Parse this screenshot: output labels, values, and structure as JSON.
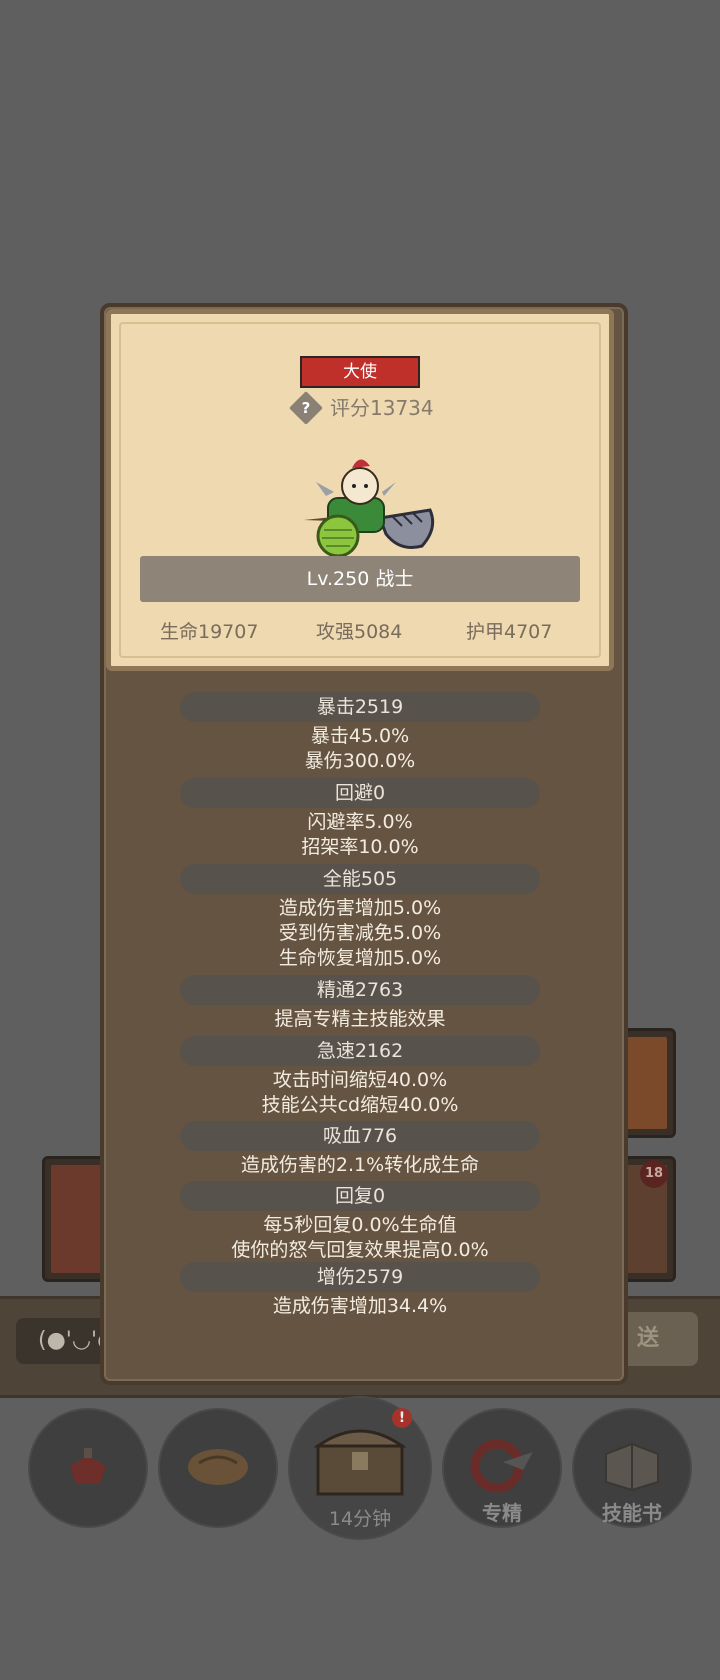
{
  "colors": {
    "overlay": "#5f5f5f",
    "panel": "#665442",
    "card": "#efd9b1",
    "title_badge": "#c0302b",
    "stat_header": "#57524c"
  },
  "background": {
    "chat_placeholder": "(●'◡'●",
    "send_label": "送",
    "badge_count": "18",
    "alert_mark": "!",
    "bottom_buttons": [
      {
        "icon": "potion-icon",
        "label": ""
      },
      {
        "icon": "bread-icon",
        "label": ""
      },
      {
        "icon": "treasure-chest-icon",
        "label": "14分钟"
      },
      {
        "icon": "specialize-icon",
        "label": "专精"
      },
      {
        "icon": "skill-book-icon",
        "label": "技能书"
      }
    ]
  },
  "hero": {
    "title": "大使",
    "score": "评分13734",
    "help_icon": "?",
    "level_class": "Lv.250 战士",
    "base_stats": {
      "hp": "生命19707",
      "attack": "攻强5084",
      "armor": "护甲4707"
    }
  },
  "stats": [
    {
      "header": "暴击2519",
      "lines": [
        "暴击45.0%",
        "暴伤300.0%"
      ]
    },
    {
      "header": "回避0",
      "lines": [
        "闪避率5.0%",
        "招架率10.0%"
      ]
    },
    {
      "header": "全能505",
      "lines": [
        "造成伤害增加5.0%",
        "受到伤害减免5.0%",
        "生命恢复增加5.0%"
      ]
    },
    {
      "header": "精通2763",
      "lines": [
        "提高专精主技能效果"
      ]
    },
    {
      "header": "急速2162",
      "lines": [
        "攻击时间缩短40.0%",
        "技能公共cd缩短40.0%"
      ]
    },
    {
      "header": "吸血776",
      "lines": [
        "造成伤害的2.1%转化成生命"
      ]
    },
    {
      "header": "回复0",
      "lines": [
        "每5秒回复0.0%生命值",
        "使你的怒气回复效果提高0.0%"
      ]
    },
    {
      "header": "增伤2579",
      "lines": [
        "造成伤害增加34.4%"
      ]
    }
  ]
}
